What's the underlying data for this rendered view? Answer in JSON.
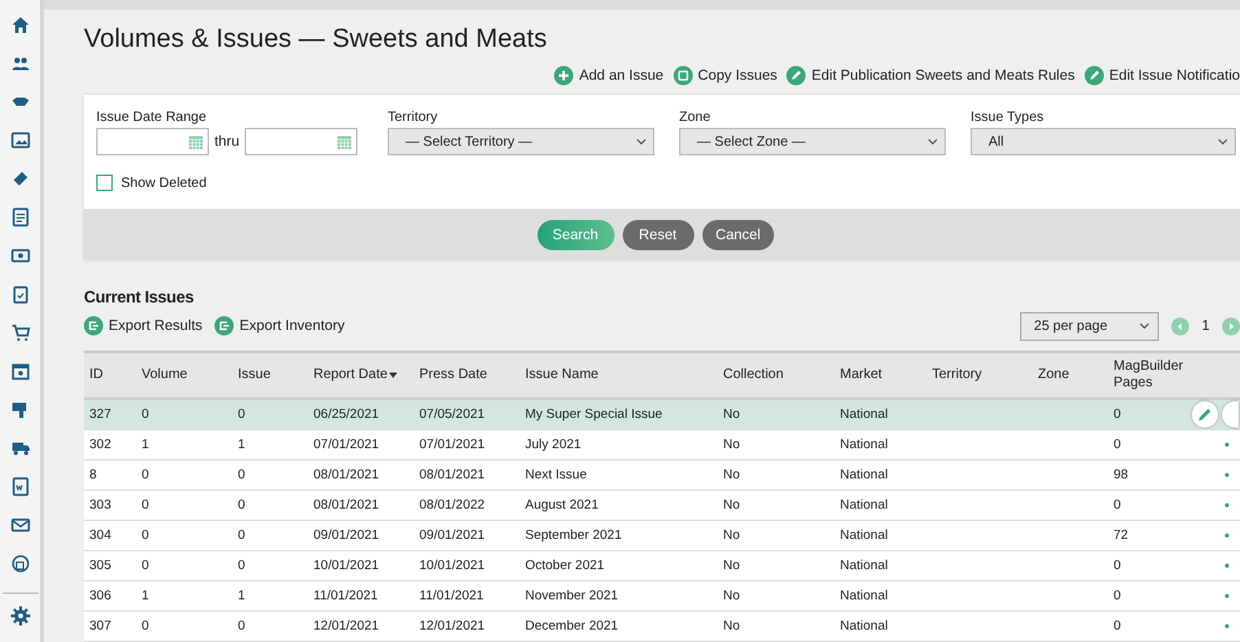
{
  "title": "Volumes & Issues — Sweets and Meats",
  "actions": [
    {
      "label": "Add an Issue",
      "kind": "add"
    },
    {
      "label": "Copy Issues",
      "kind": "copy"
    },
    {
      "label": "Edit Publication Sweets and Meats Rules",
      "kind": "edit"
    },
    {
      "label": "Edit Issue Notificatio",
      "kind": "edit"
    }
  ],
  "filters": {
    "date_range": {
      "label": "Issue Date Range",
      "separator": "thru"
    },
    "selects": [
      {
        "label": "Territory",
        "value": "— Select Territory —"
      },
      {
        "label": "Zone",
        "value": "— Select Zone —"
      },
      {
        "label": "Issue Types",
        "value": "All"
      }
    ],
    "show_deleted": {
      "label": "Show Deleted",
      "checked": false
    }
  },
  "buttons": [
    {
      "label": "Search",
      "kind": "primary"
    },
    {
      "label": "Reset",
      "kind": "secondary"
    },
    {
      "label": "Cancel",
      "kind": "secondary"
    }
  ],
  "section_title": "Current Issues",
  "exports": [
    "Export Results",
    "Export Inventory"
  ],
  "pagination": {
    "per_page": "25 per page",
    "page": "1"
  },
  "table": {
    "columns": [
      {
        "label": "ID",
        "sorted": false
      },
      {
        "label": "Volume",
        "sorted": false
      },
      {
        "label": "Issue",
        "sorted": false
      },
      {
        "label": "Report Date",
        "sorted": true
      },
      {
        "label": "Press Date",
        "sorted": false
      },
      {
        "label": "Issue Name",
        "sorted": false
      },
      {
        "label": "Collection",
        "sorted": false
      },
      {
        "label": "Market",
        "sorted": false
      },
      {
        "label": "Territory",
        "sorted": false
      },
      {
        "label": "Zone",
        "sorted": false
      },
      {
        "label": "MagBuilder Pages",
        "sorted": false
      }
    ],
    "rows": [
      {
        "selected": true,
        "cells": [
          "327",
          "0",
          "0",
          "06/25/2021",
          "07/05/2021",
          "My Super Special Issue",
          "No",
          "National",
          "",
          "",
          "0"
        ]
      },
      {
        "selected": false,
        "cells": [
          "302",
          "1",
          "1",
          "07/01/2021",
          "07/01/2021",
          "July 2021",
          "No",
          "National",
          "",
          "",
          "0"
        ]
      },
      {
        "selected": false,
        "cells": [
          "8",
          "0",
          "0",
          "08/01/2021",
          "08/01/2021",
          "Next Issue",
          "No",
          "National",
          "",
          "",
          "98"
        ]
      },
      {
        "selected": false,
        "cells": [
          "303",
          "0",
          "0",
          "08/01/2021",
          "08/01/2022",
          "August 2021",
          "No",
          "National",
          "",
          "",
          "0"
        ]
      },
      {
        "selected": false,
        "cells": [
          "304",
          "0",
          "0",
          "09/01/2021",
          "09/01/2021",
          "September 2021",
          "No",
          "National",
          "",
          "",
          "72"
        ]
      },
      {
        "selected": false,
        "cells": [
          "305",
          "0",
          "0",
          "10/01/2021",
          "10/01/2021",
          "October 2021",
          "No",
          "National",
          "",
          "",
          "0"
        ]
      },
      {
        "selected": false,
        "cells": [
          "306",
          "1",
          "1",
          "11/01/2021",
          "11/01/2021",
          "November 2021",
          "No",
          "National",
          "",
          "",
          "0"
        ]
      },
      {
        "selected": false,
        "cells": [
          "307",
          "0",
          "0",
          "12/01/2021",
          "12/01/2021",
          "December 2021",
          "No",
          "National",
          "",
          "",
          "0"
        ]
      }
    ]
  }
}
